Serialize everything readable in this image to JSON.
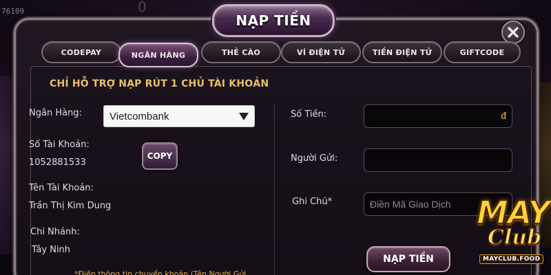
{
  "background": {
    "counter": "76109",
    "zero": "0"
  },
  "title": "NẠP TIỀN",
  "tabs": [
    {
      "label": "CODEPAY",
      "active": false
    },
    {
      "label": "NGÂN HÀNG",
      "active": true
    },
    {
      "label": "THẺ CÀO",
      "active": false
    },
    {
      "label": "VÍ ĐIỆN TỬ",
      "active": false
    },
    {
      "label": "TIỀN ĐIỆN TỬ",
      "active": false
    },
    {
      "label": "GIFTCODE",
      "active": false
    }
  ],
  "notice": "CHỈ HỖ TRỢ NẠP RÚT 1 CHỦ TÀI KHOẢN",
  "bank": {
    "label": "Ngân Hàng:",
    "selected": "Vietcombank"
  },
  "account_number": {
    "label": "Số Tài Khoản:",
    "value": "1052881533"
  },
  "copy_label": "COPY",
  "account_name": {
    "label": "Tên Tài Khoản:",
    "value": "Trần Thị Kim Dung"
  },
  "branch": {
    "label": "Chi Nhánh:",
    "value": "Tây Ninh"
  },
  "form": {
    "amount_label": "Số Tiền:",
    "amount_value": "",
    "currency": "đ",
    "sender_label": "Người Gửi:",
    "sender_value": "",
    "note_label": "Ghi Chú*",
    "note_placeholder": "Điền Mã Giao Dịch"
  },
  "submit_label": "NẠP TIỀN",
  "footnote": "*Điền thông tin chuyển khoản (Tên Người Gửi...",
  "logo": {
    "top": "MAY",
    "middle": "Club",
    "bottom": "MAYCLUB.FOOD"
  },
  "colors": {
    "accent_gold": "#e8c16a",
    "panel_bg": "#1a121c",
    "active_tab": "#7a5079"
  }
}
